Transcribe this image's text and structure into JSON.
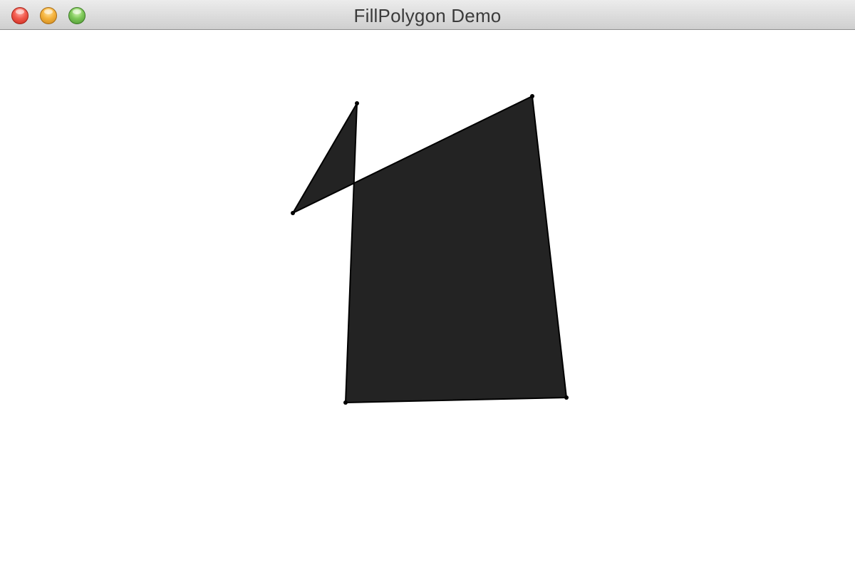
{
  "window": {
    "title": "FillPolygon Demo"
  },
  "polygon": {
    "fill_color": "#232323",
    "stroke_color": "#000000",
    "vertex_color": "#000000"
  }
}
